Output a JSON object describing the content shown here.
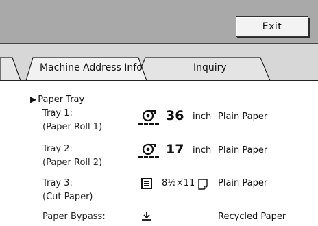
{
  "header": {
    "exit_label": "Exit"
  },
  "tabs": [
    {
      "label": "Machine Address Info"
    },
    {
      "label": "Inquiry"
    }
  ],
  "section": {
    "title": "Paper Tray"
  },
  "trays": [
    {
      "name": "Tray 1:",
      "sub": "(Paper Roll 1)",
      "icon": "paper-roll-icon",
      "size_value": "36",
      "size_unit": "inch",
      "paper_type": "Plain Paper"
    },
    {
      "name": "Tray 2:",
      "sub": "(Paper Roll 2)",
      "icon": "paper-roll-icon",
      "size_value": "17",
      "size_unit": "inch",
      "paper_type": "Plain Paper"
    },
    {
      "name": "Tray 3:",
      "sub": "(Cut Paper)",
      "icon": "cut-paper-stack-icon",
      "size_text": "8½×11",
      "orientation_icon": "portrait-sheet-icon",
      "paper_type": "Plain Paper"
    },
    {
      "name": "Paper Bypass:",
      "icon": "bypass-tray-icon",
      "paper_type": "Recycled Paper"
    }
  ]
}
